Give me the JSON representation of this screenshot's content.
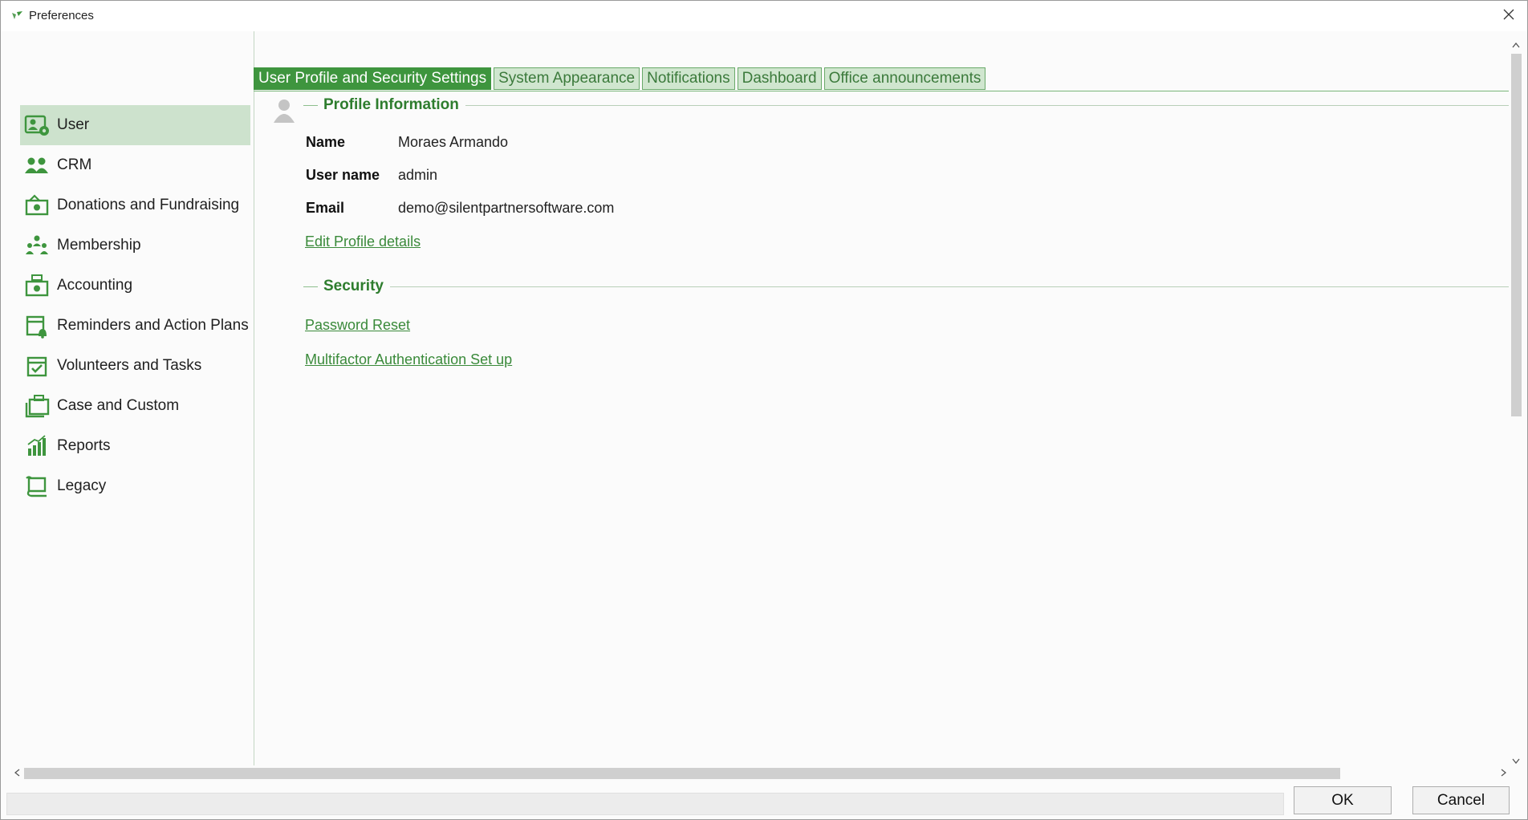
{
  "window": {
    "title": "Preferences"
  },
  "sidebar": {
    "items": [
      {
        "label": "User",
        "icon": "user-settings-icon",
        "selected": true
      },
      {
        "label": "CRM",
        "icon": "people-icon"
      },
      {
        "label": "Donations and Fundraising",
        "icon": "donation-icon"
      },
      {
        "label": "Membership",
        "icon": "membership-icon"
      },
      {
        "label": "Accounting",
        "icon": "accounting-icon"
      },
      {
        "label": "Reminders and Action Plans",
        "icon": "calendar-bell-icon"
      },
      {
        "label": "Volunteers and Tasks",
        "icon": "calendar-check-icon"
      },
      {
        "label": "Case and Custom",
        "icon": "briefcase-icon"
      },
      {
        "label": "Reports",
        "icon": "bar-chart-icon"
      },
      {
        "label": "Legacy",
        "icon": "scroll-icon"
      }
    ]
  },
  "tabs": [
    {
      "label": "User Profile and Security Settings",
      "active": true
    },
    {
      "label": "System Appearance"
    },
    {
      "label": "Notifications"
    },
    {
      "label": "Dashboard"
    },
    {
      "label": "Office announcements"
    }
  ],
  "profile": {
    "heading": "Profile Information",
    "fields": [
      {
        "label": "Name",
        "value": "Moraes Armando"
      },
      {
        "label": "User name",
        "value": "admin"
      },
      {
        "label": "Email",
        "value": "demo@silentpartnersoftware.com"
      }
    ],
    "edit_link": "Edit Profile details"
  },
  "security": {
    "heading": "Security",
    "links": [
      "Password Reset",
      "Multifactor Authentication Set up"
    ]
  },
  "buttons": {
    "ok": "OK",
    "cancel": "Cancel"
  },
  "colors": {
    "accent": "#3e953e",
    "selected_bg": "#cde2cd",
    "tab_bg": "#d0e6cf",
    "link": "#3a8a3a"
  }
}
